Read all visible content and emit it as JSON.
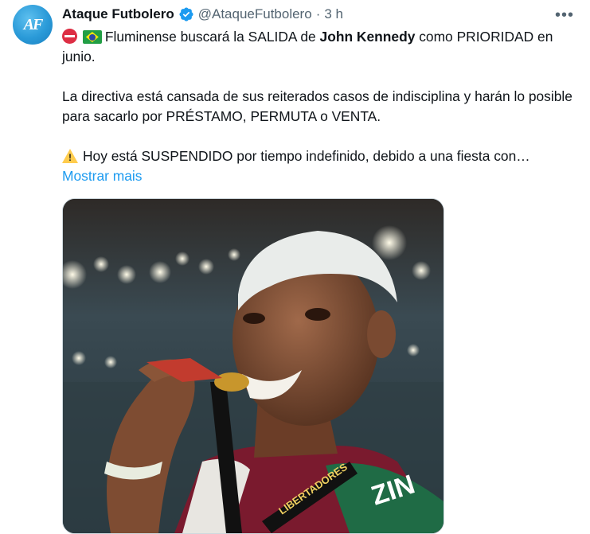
{
  "author": {
    "name": "Ataque Futbolero",
    "handle": "@AtaqueFutbolero",
    "separator": "·",
    "time": "3 h",
    "verified": true
  },
  "tweet": {
    "line1_pre": "Fluminense buscará la SALIDA de ",
    "line1_bold": "John Kennedy",
    "line1_post": " como PRIORIDAD en junio.",
    "para2": "La directiva está cansada de sus reiterados casos de indisciplina y harán lo posible para sacarlo por PRÉSTAMO, PERMUTA o VENTA.",
    "para3": "Hoy está SUSPENDIDO por tiempo indefinido, debido a una fiesta con…",
    "show_more": "Mostrar mais"
  },
  "media": {
    "jersey_text": "ZIN",
    "lanyard_text": "LIBERTADORES"
  },
  "icons": {
    "more": "more-horizontal-icon",
    "verified": "verified-badge-icon"
  },
  "colors": {
    "link": "#1d9bf0",
    "secondary_text": "#536471",
    "verified": "#1d9bf0"
  }
}
